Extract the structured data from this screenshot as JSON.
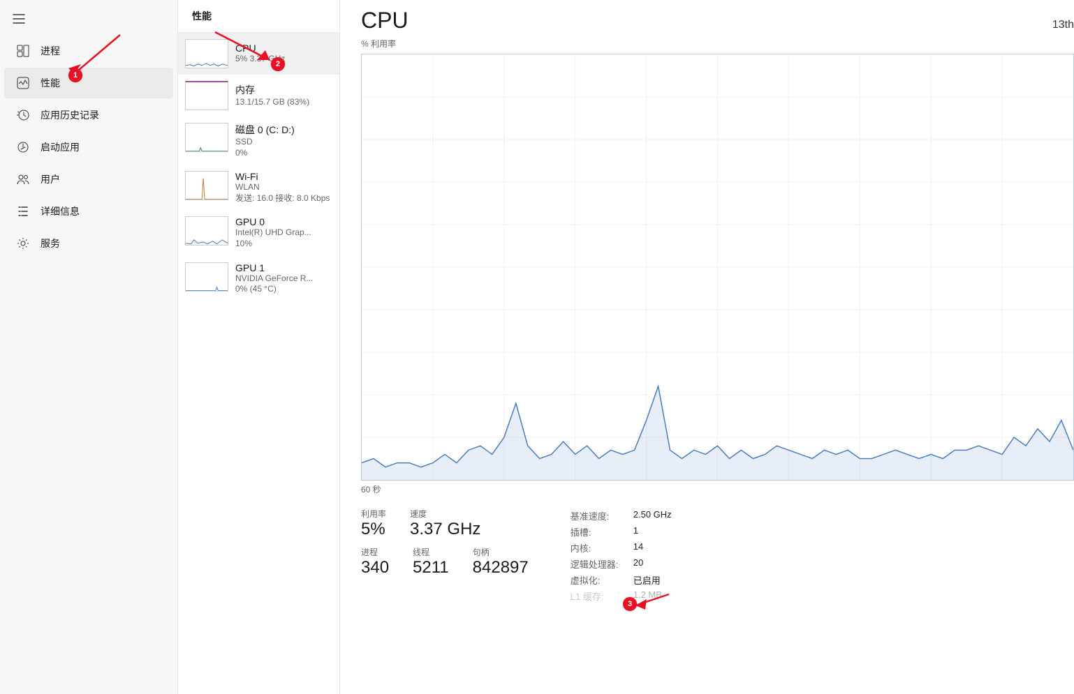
{
  "page": {
    "title": "性能",
    "main_title": "性能"
  },
  "sidebar": {
    "items": [
      {
        "label": "进程"
      },
      {
        "label": "性能"
      },
      {
        "label": "应用历史记录"
      },
      {
        "label": "启动应用"
      },
      {
        "label": "用户"
      },
      {
        "label": "详细信息"
      },
      {
        "label": "服务"
      }
    ]
  },
  "resources": {
    "cpu": {
      "title": "CPU",
      "sub": "5%  3.37 GHz"
    },
    "mem": {
      "title": "内存",
      "sub": "13.1/15.7 GB (83%)"
    },
    "disk": {
      "title": "磁盘 0 (C: D:)",
      "sub1": "SSD",
      "sub2": "0%"
    },
    "wifi": {
      "title": "Wi-Fi",
      "sub1": "WLAN",
      "sub2": "发送: 16.0 接收: 8.0 Kbps"
    },
    "gpu0": {
      "title": "GPU 0",
      "sub1": "Intel(R) UHD Grap...",
      "sub2": "10%"
    },
    "gpu1": {
      "title": "GPU 1",
      "sub1": "NVIDIA GeForce R...",
      "sub2": "0% (45 °C)"
    }
  },
  "detail": {
    "heading": "CPU",
    "model": "13th",
    "y_label": "% 利用率",
    "x_label": "60 秒",
    "stats": {
      "util_label": "利用率",
      "util_val": "5%",
      "speed_label": "速度",
      "speed_val": "3.37 GHz",
      "proc_label": "进程",
      "proc_val": "340",
      "thr_label": "线程",
      "thr_val": "5211",
      "hnd_label": "句柄",
      "hnd_val": "842897"
    },
    "kv": {
      "base_k": "基准速度:",
      "base_v": "2.50 GHz",
      "sock_k": "插槽:",
      "sock_v": "1",
      "core_k": "内核:",
      "core_v": "14",
      "lp_k": "逻辑处理器:",
      "lp_v": "20",
      "virt_k": "虚拟化:",
      "virt_v": "已启用",
      "l1_k": "L1 缓存:",
      "l1_v": "1.2 MB"
    }
  },
  "annotations": {
    "b1": "1",
    "b2": "2",
    "b3": "3"
  },
  "chart_data": {
    "type": "line",
    "title": "% 利用率",
    "xlabel": "60 秒",
    "ylabel": "% 利用率",
    "ylim": [
      0,
      100
    ],
    "xlim_seconds": [
      60,
      0
    ],
    "series": [
      {
        "name": "CPU 利用率 (%)",
        "values": [
          4,
          5,
          3,
          4,
          4,
          3,
          4,
          6,
          4,
          7,
          8,
          6,
          10,
          18,
          8,
          5,
          6,
          9,
          6,
          8,
          5,
          7,
          6,
          7,
          14,
          22,
          7,
          5,
          7,
          6,
          8,
          5,
          7,
          5,
          6,
          8,
          7,
          6,
          5,
          7,
          6,
          7,
          5,
          5,
          6,
          7,
          6,
          5,
          6,
          5,
          7,
          7,
          8,
          7,
          6,
          10,
          8,
          12,
          9,
          14,
          7
        ]
      }
    ]
  }
}
